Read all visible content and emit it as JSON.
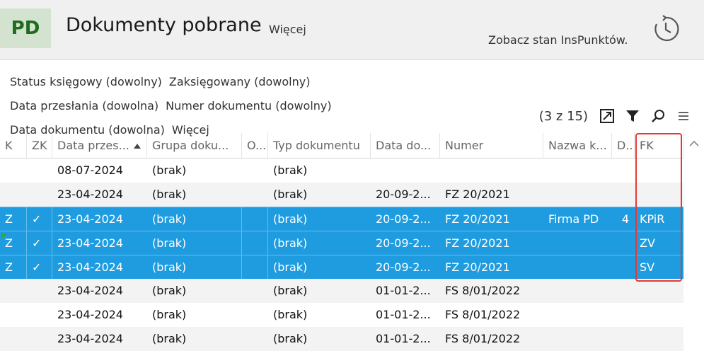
{
  "header": {
    "logo": "PD",
    "title": "Dokumenty pobrane",
    "more": "Więcej",
    "status_link": "Zobacz stan InsPunktów."
  },
  "filters": {
    "row1": [
      "Status księgowy (dowolny)",
      "Zaksięgowany (dowolny)"
    ],
    "row2": [
      "Data przesłania (dowolna)",
      "Numer dokumentu (dowolny)"
    ],
    "row3": [
      "Data dokumentu (dowolna)",
      "Więcej"
    ]
  },
  "toolbar": {
    "count": "(3 z 15)",
    "icons": [
      "expand-icon",
      "filter-icon",
      "search-icon",
      "menu-icon"
    ]
  },
  "table": {
    "columns": [
      "K",
      "ZK",
      "Data przes...",
      "Grupa doku...",
      "O...",
      "Typ dokumentu",
      "Data do...",
      "Numer",
      "Nazwa k...",
      "D...",
      "FK"
    ],
    "sorted_column": "Data przes...",
    "rows": [
      {
        "k": "",
        "zk": "",
        "data_przes": "08-07-2024",
        "grupa": "(brak)",
        "o": "",
        "typ": "(brak)",
        "data_dok": "",
        "numer": "",
        "nazwa": "",
        "d": "",
        "fk": "",
        "selected": false,
        "alt": false
      },
      {
        "k": "",
        "zk": "",
        "data_przes": "23-04-2024",
        "grupa": "(brak)",
        "o": "",
        "typ": "(brak)",
        "data_dok": "20-09-2...",
        "numer": "FZ 20/2021",
        "nazwa": "",
        "d": "",
        "fk": "",
        "selected": false,
        "alt": true
      },
      {
        "k": "Z",
        "zk": "✓",
        "data_przes": "23-04-2024",
        "grupa": "(brak)",
        "o": "",
        "typ": "(brak)",
        "data_dok": "20-09-2...",
        "numer": "FZ 20/2021",
        "nazwa": "Firma PD",
        "d": "4",
        "fk": "KPiR",
        "selected": true,
        "alt": false
      },
      {
        "k": "Z",
        "zk": "✓",
        "data_przes": "23-04-2024",
        "grupa": "(brak)",
        "o": "",
        "typ": "(brak)",
        "data_dok": "20-09-2...",
        "numer": "FZ 20/2021",
        "nazwa": "",
        "d": "",
        "fk": "ZV",
        "selected": true,
        "alt": false
      },
      {
        "k": "Z",
        "zk": "✓",
        "data_przes": "23-04-2024",
        "grupa": "(brak)",
        "o": "",
        "typ": "(brak)",
        "data_dok": "20-09-2...",
        "numer": "FZ 20/2021",
        "nazwa": "",
        "d": "",
        "fk": "SV",
        "selected": true,
        "alt": false
      },
      {
        "k": "",
        "zk": "",
        "data_przes": "23-04-2024",
        "grupa": "(brak)",
        "o": "",
        "typ": "(brak)",
        "data_dok": "01-01-2...",
        "numer": "FS 8/01/2022",
        "nazwa": "",
        "d": "",
        "fk": "",
        "selected": false,
        "alt": true
      },
      {
        "k": "",
        "zk": "",
        "data_przes": "23-04-2024",
        "grupa": "(brak)",
        "o": "",
        "typ": "(brak)",
        "data_dok": "01-01-2...",
        "numer": "FS 8/01/2022",
        "nazwa": "",
        "d": "",
        "fk": "",
        "selected": false,
        "alt": false
      },
      {
        "k": "",
        "zk": "",
        "data_przes": "23-04-2024",
        "grupa": "(brak)",
        "o": "",
        "typ": "(brak)",
        "data_dok": "01-01-2...",
        "numer": "FS 8/01/2022",
        "nazwa": "",
        "d": "",
        "fk": "",
        "selected": false,
        "alt": true
      }
    ]
  },
  "colors": {
    "selection": "#1f9ce0",
    "logo_bg": "#d3e3d0",
    "logo_text": "#1f6b1f",
    "highlight_border": "#e53935"
  }
}
